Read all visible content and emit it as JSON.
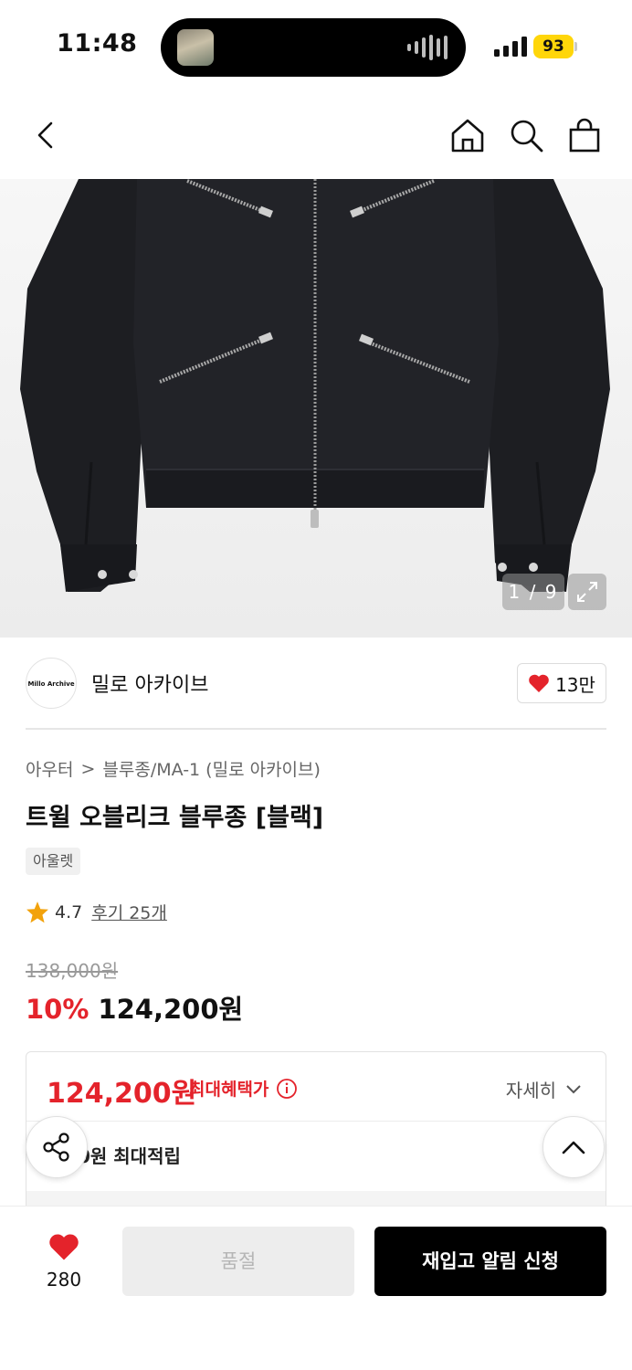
{
  "status_bar": {
    "time": "11:48",
    "battery": "93"
  },
  "nav": {
    "back_icon": "chevron-left-icon",
    "home_icon": "home-icon",
    "search_icon": "search-icon",
    "cart_icon": "shopping-bag-icon"
  },
  "gallery": {
    "counter": "1 / 9",
    "expand_icon": "expand-icon",
    "image_subject": "black twill jacket with diagonal zippers"
  },
  "brand": {
    "logo_text": "Millo Archive",
    "name": "밀로 아카이브",
    "like_count": "13만",
    "like_icon": "heart-icon",
    "accent": "#e4232b"
  },
  "breadcrumb": {
    "category": "아우터",
    "separator": ">",
    "subcategory": "블루종/MA-1 (밀로 아카이브)"
  },
  "product": {
    "title": "트윌 오블리크 블루종 [블랙]",
    "tag": "아울렛",
    "rating": "4.7",
    "reviews": "후기 25개",
    "original_price": "138,000원",
    "discount": "10%",
    "price": "124,200원"
  },
  "benefit": {
    "price": "124,200원",
    "label": "최대혜택가",
    "detail": "자세히",
    "points": "0원 최대적립"
  },
  "action_bar": {
    "wish_count": "280",
    "soldout_label": "품절",
    "restock_label": "재입고 알림 신청"
  }
}
